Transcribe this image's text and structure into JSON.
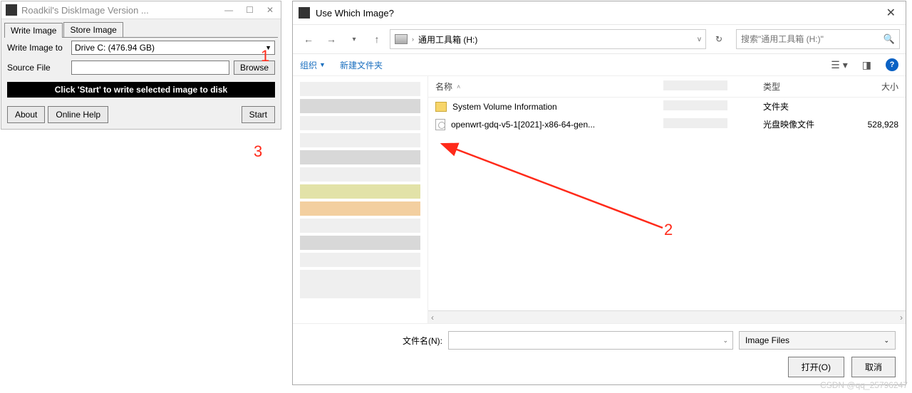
{
  "diskimage": {
    "title": "Roadkil's DiskImage Version ...",
    "tabs": {
      "write": "Write Image",
      "store": "Store Image"
    },
    "write_to_label": "Write Image to",
    "drive_value": "Drive C: (476.94 GB)",
    "source_label": "Source File",
    "source_value": "",
    "browse": "Browse",
    "instruction": "Click 'Start' to write selected image to disk",
    "about": "About",
    "help": "Online Help",
    "start": "Start"
  },
  "filedialog": {
    "title": "Use Which Image?",
    "breadcrumb": "通用工具箱 (H:)",
    "breadcrumb_sep": "›",
    "refresh_icon": "↻",
    "search_placeholder": "搜索\"通用工具箱 (H:)\"",
    "toolbar": {
      "organize": "组织",
      "newfolder": "新建文件夹"
    },
    "columns": {
      "name": "名称",
      "date": "",
      "type": "类型",
      "size": "大小"
    },
    "rows": [
      {
        "name": "System Volume Information",
        "type": "文件夹",
        "size": "",
        "kind": "folder"
      },
      {
        "name": "openwrt-gdq-v5-1[2021]-x86-64-gen...",
        "type": "光盘映像文件",
        "size": "528,928",
        "kind": "file"
      }
    ],
    "filename_label": "文件名(N):",
    "filetype_value": "Image Files",
    "open": "打开(O)",
    "cancel": "取消"
  },
  "annotations": {
    "a1": "1",
    "a2": "2",
    "a3": "3"
  },
  "watermark": "CSDN @qq_25796247"
}
